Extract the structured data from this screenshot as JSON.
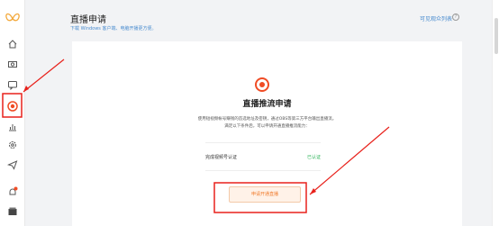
{
  "sidebar": {
    "logo": "butterfly-logo",
    "items": [
      {
        "icon": "home-icon"
      },
      {
        "icon": "camera-icon"
      },
      {
        "icon": "message-icon"
      },
      {
        "icon": "live-icon",
        "active": true
      },
      {
        "icon": "chart-icon"
      },
      {
        "icon": "settings-icon"
      },
      {
        "icon": "paper-plane-icon"
      },
      {
        "icon": "notification-icon",
        "badge": true
      },
      {
        "icon": "wallet-icon"
      }
    ]
  },
  "header": {
    "title": "直播申请",
    "subtitle": "下载 Windows 客户端、电脑开播更方便。",
    "view_list": "可见观众列表"
  },
  "main": {
    "heading": "直播推流申请",
    "desc_line1": "使用短视频帐号赚钱的首选地址及密钥，通过OBS等第三方平台输出直播流。",
    "desc_line2": "满足以下条件后，可以申请开通直播推流能力：",
    "requirement": {
      "label": "完成视频号认证",
      "status": "已认证"
    },
    "apply_button": "申请开通直播"
  },
  "colors": {
    "accent": "#f04c25",
    "annotation_red": "#e8211b",
    "success": "#2fb45a",
    "link": "#4a8ccf"
  }
}
